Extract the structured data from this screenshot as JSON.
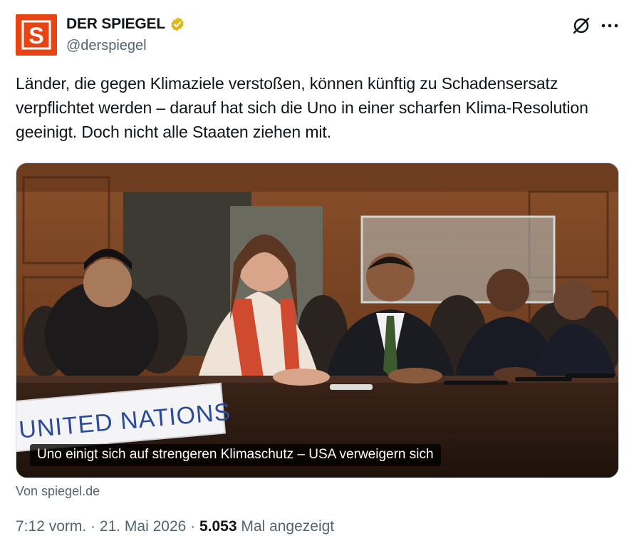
{
  "author": {
    "display_name": "DER SPIEGEL",
    "handle": "@derspiegel",
    "avatar_letter": "S",
    "avatar_color": "#e64415",
    "verified_badge_color": "#e2b719"
  },
  "tweet": {
    "text": "Länder, die gegen Klimaziele verstoßen, können künftig zu Schadensersatz verpflichtet werden – darauf hat sich die Uno in einer scharfen Klima-Resolution geeinigt. Doch nicht alle Staaten ziehen mit."
  },
  "card": {
    "sign_text": "UNITED NATIONS",
    "caption": "Uno einigt sich auf strengeren Klimaschutz – USA verweigern sich",
    "source": "Von spiegel.de"
  },
  "meta": {
    "time": "7:12 vorm.",
    "sep1": " · ",
    "date": "21. Mai 2026",
    "sep2": " · ",
    "views": "5.053",
    "views_label": " Mal angezeigt"
  },
  "icons": {
    "grok": "grok-icon",
    "more": "more-icon",
    "verified": "verified-badge-icon"
  }
}
